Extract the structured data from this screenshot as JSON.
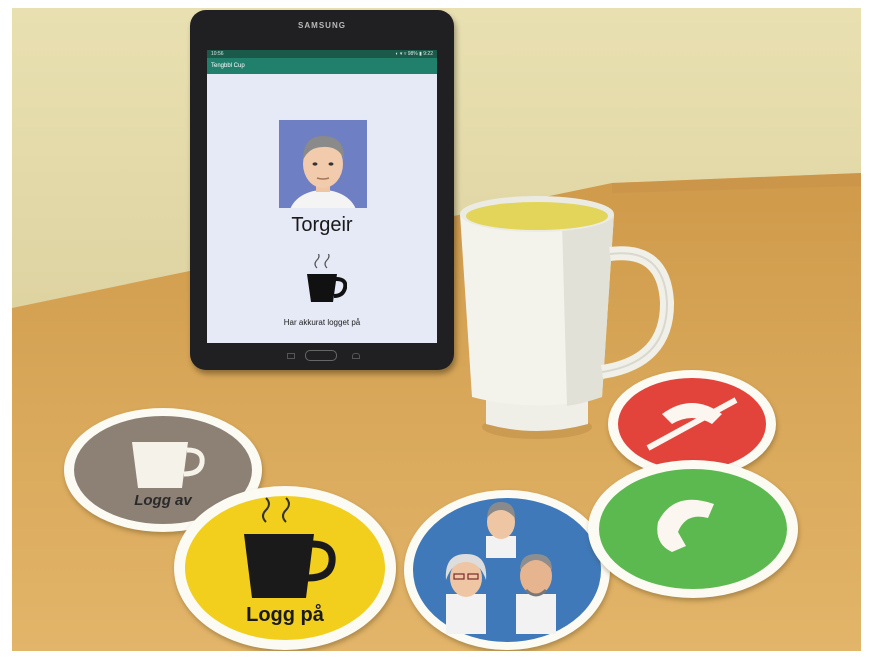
{
  "tablet": {
    "brand": "SAMSUNG",
    "app_title": "Tengbbl Cup",
    "status_left": "10:56",
    "status_right": "◐ ▾ ▿ 98% ▮ 9:22",
    "user_name": "Torgeir",
    "status_message": "Har akkurat logget på"
  },
  "discs": {
    "logout_label": "Logg av",
    "login_label": "Logg på"
  },
  "colors": {
    "logout_disc": "#8d8175",
    "login_disc": "#f1cf1c",
    "people_disc": "#3f79b9",
    "hangup_disc": "#e2443c",
    "call_disc": "#5cb94f",
    "screen_bg": "#e6e9f6",
    "app_bar": "#20806b"
  },
  "icons": [
    "coffee-cup-icon",
    "phone-handset-icon",
    "phone-hangup-icon",
    "avatar-icon"
  ]
}
